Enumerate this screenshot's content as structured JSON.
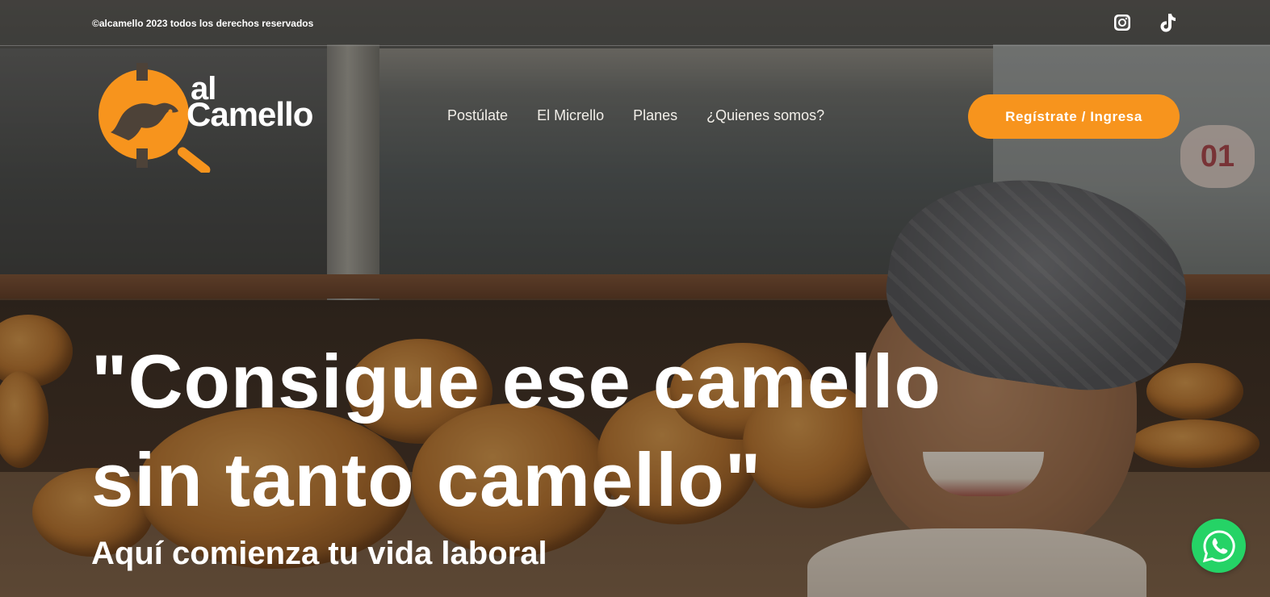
{
  "topbar": {
    "copyright": "©alcamello 2023 todos los derechos reservados",
    "social": [
      "instagram-icon",
      "tiktok-icon"
    ]
  },
  "logo": {
    "line1": "al",
    "line2": "Camello",
    "color": "#f7941d"
  },
  "nav": {
    "items": [
      {
        "label": "Postúlate"
      },
      {
        "label": "El Micrello"
      },
      {
        "label": "Planes"
      },
      {
        "label": "¿Quienes somos?"
      }
    ]
  },
  "cta": {
    "label": "Regístrate / Ingresa",
    "color": "#f7941d"
  },
  "hero": {
    "headline_line1": "\"Consigue ese camello",
    "headline_line2": "sin tanto camello\"",
    "subheadline": "Aquí comienza tu vida laboral",
    "background_tag": "01"
  },
  "whatsapp": {
    "icon": "whatsapp-icon",
    "color": "#25d366"
  }
}
